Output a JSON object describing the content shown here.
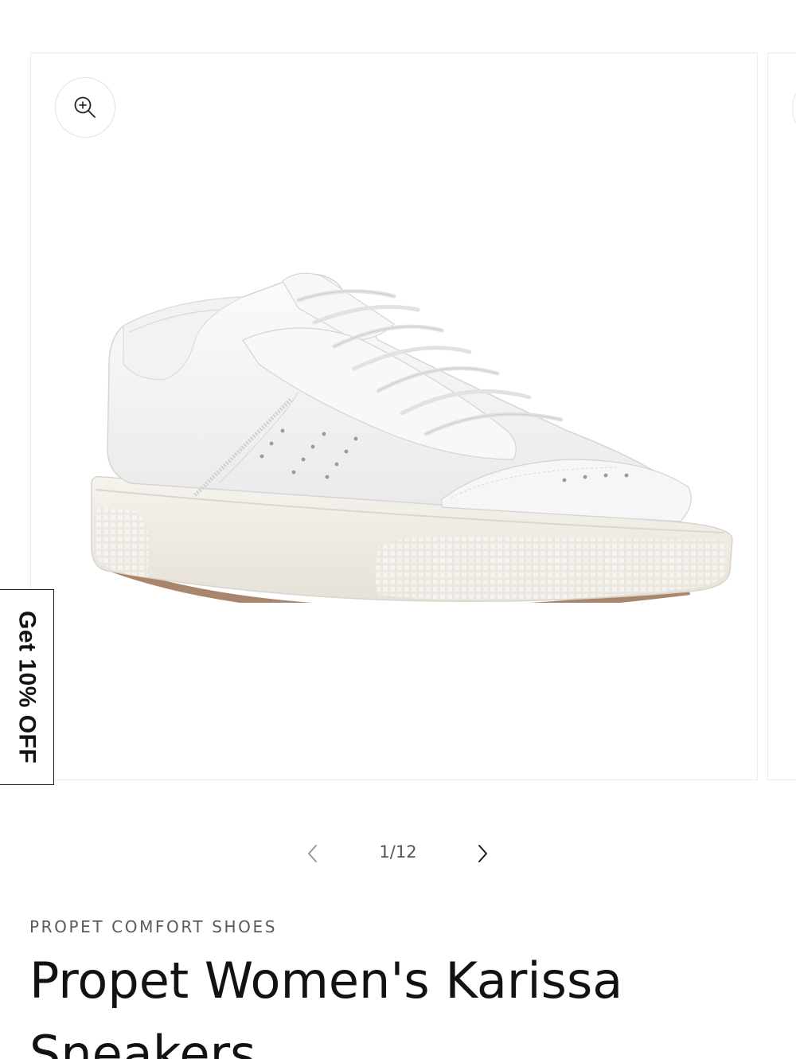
{
  "promo": {
    "label": "Get 10% OFF"
  },
  "gallery": {
    "current": 1,
    "total": 12,
    "counter_text": "1/12",
    "image_subject": "white leather lace-up sneaker",
    "icons": {
      "zoom": "zoom-in-icon",
      "prev": "chevron-left-icon",
      "next": "chevron-right-icon"
    }
  },
  "product": {
    "vendor": "PROPET COMFORT SHOES",
    "title": "Propet Women's Karissa Sneakers"
  },
  "colors": {
    "text": "#121212",
    "muted_text": "#5a5a5a",
    "border": "#ececec",
    "background": "#ffffff"
  }
}
